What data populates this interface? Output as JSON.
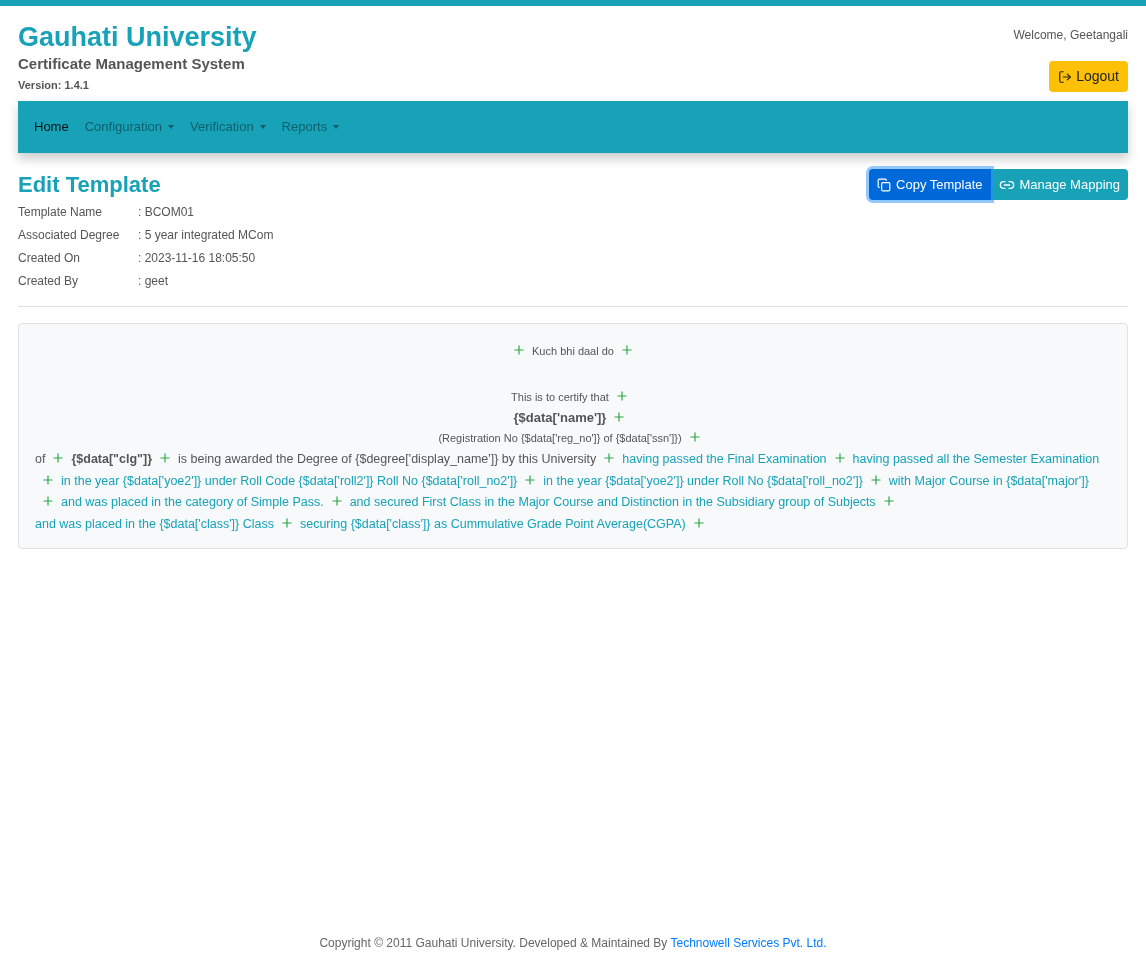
{
  "header": {
    "title": "Gauhati University",
    "subtitle": "Certificate Management System",
    "version": "Version: 1.4.1",
    "welcome": "Welcome, Geetangali",
    "logout": "Logout"
  },
  "nav": [
    {
      "label": "Home",
      "selected": true,
      "dropdown": false
    },
    {
      "label": "Configuration",
      "selected": false,
      "dropdown": true
    },
    {
      "label": "Verification",
      "selected": false,
      "dropdown": true
    },
    {
      "label": "Reports",
      "selected": false,
      "dropdown": true
    }
  ],
  "page": {
    "title": "Edit Template",
    "buttons": [
      {
        "label": "Copy Template",
        "kind": "copy",
        "focused": true
      },
      {
        "label": "Manage Mapping",
        "kind": "link",
        "focused": false
      }
    ]
  },
  "details": [
    {
      "label": "Template Name",
      "value": ": BCOM01"
    },
    {
      "label": "Associated Degree",
      "value": ": 5 year integrated MCom"
    },
    {
      "label": "Created On",
      "value": ": 2023-11-16 18:05:50"
    },
    {
      "label": "Created By",
      "value": ": geet"
    }
  ],
  "template": {
    "centered": [
      {
        "text": "Kuch bhi daal do",
        "kind": "heading"
      },
      {
        "text": "This is to certify that",
        "kind": "small"
      },
      {
        "text": "{$data['name']}",
        "kind": "bold"
      },
      {
        "text": "(Registration No {$data['reg_no']} of {$data['ssn']})",
        "kind": "small"
      }
    ],
    "segments": [
      {
        "text": "of",
        "kind": "plain"
      },
      {
        "text": "{$data[\"clg\"]}",
        "kind": "bold"
      },
      {
        "text": "is being awarded the Degree of {$degree['display_name']} by this University",
        "kind": "plain"
      },
      {
        "text": "having passed the Final Examination",
        "kind": "link"
      },
      {
        "text": "having passed all the Semester Examination",
        "kind": "link"
      },
      {
        "text": "in the year {$data['yoe2']} under Roll Code {$data['roll2']} Roll No {$data['roll_no2']}",
        "kind": "link"
      },
      {
        "text": "in the year {$data['yoe2']} under Roll No {$data['roll_no2']}",
        "kind": "link"
      },
      {
        "text": "with Major Course in {$data['major']}",
        "kind": "link"
      },
      {
        "text": "and was placed in the category of Simple Pass.",
        "kind": "link"
      },
      {
        "text": "and secured First Class in the Major Course and Distinction in the Subsidiary group of Subjects",
        "kind": "link"
      },
      {
        "text": "and was placed in the {$data['class']} Class",
        "kind": "link"
      },
      {
        "text": "securing {$data['class']} as Cummulative Grade Point Average(CGPA)",
        "kind": "link"
      }
    ]
  },
  "footer": {
    "text": "Copyright © 2011 Gauhati University. Developed & Maintained By",
    "link": "Technowell Services Pvt. Ltd."
  }
}
